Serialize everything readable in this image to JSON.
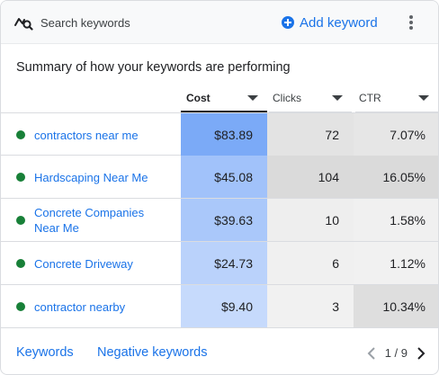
{
  "header": {
    "title": "Search keywords",
    "icon": "keyword-search-icon",
    "add_label": "Add keyword",
    "more_icon": "more-vert-icon"
  },
  "summary_title": "Summary of how your keywords are performing",
  "columns": [
    {
      "label": "Cost",
      "sorted": true
    },
    {
      "label": "Clicks",
      "sorted": false
    },
    {
      "label": "CTR",
      "sorted": false
    }
  ],
  "rows": [
    {
      "keyword": "contractors near me",
      "status": "enabled",
      "cost": "$83.89",
      "clicks": "72",
      "ctr": "7.07%"
    },
    {
      "keyword": "Hardscaping Near Me",
      "status": "enabled",
      "cost": "$45.08",
      "clicks": "104",
      "ctr": "16.05%"
    },
    {
      "keyword": "Concrete Companies Near Me",
      "status": "enabled",
      "cost": "$39.63",
      "clicks": "10",
      "ctr": "1.58%"
    },
    {
      "keyword": "Concrete Driveway",
      "status": "enabled",
      "cost": "$24.73",
      "clicks": "6",
      "ctr": "1.12%"
    },
    {
      "keyword": "contractor nearby",
      "status": "enabled",
      "cost": "$9.40",
      "clicks": "3",
      "ctr": "10.34%"
    }
  ],
  "colors": {
    "accent": "#1a73e8",
    "status_enabled": "#188038",
    "cost_heat": [
      "#7baaf7",
      "#a1c2fa",
      "#aac8fa",
      "#bad2fb",
      "#c6dafc"
    ],
    "clicks_heat": [
      "#e3e3e3",
      "#dadada",
      "#eeeeee",
      "#f0f0f0",
      "#f1f1f1"
    ],
    "ctr_heat": [
      "#e6e6e6",
      "#dadada",
      "#f0f0f0",
      "#f1f1f1",
      "#dedede"
    ]
  },
  "footer": {
    "link_keywords": "Keywords",
    "link_negative": "Negative keywords",
    "page_text": "1 / 9"
  }
}
